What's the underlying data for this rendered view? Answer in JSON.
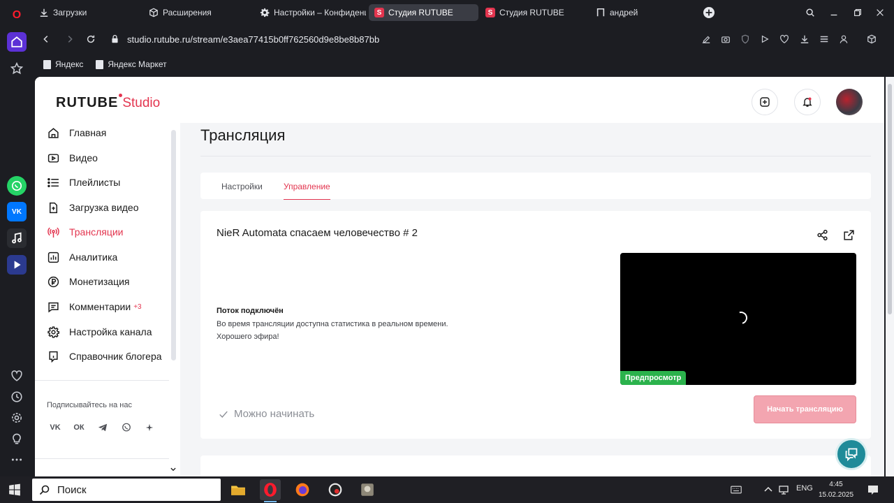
{
  "browser": {
    "tabs": [
      {
        "label": "Загрузки",
        "icon": "download-icon"
      },
      {
        "label": "Расширения",
        "icon": "cube-icon"
      },
      {
        "label": "Настройки – Конфиденц",
        "icon": "gear-icon"
      },
      {
        "label": "Студия RUTUBE",
        "icon": "rutube-s-icon",
        "active": true
      },
      {
        "label": "Студия RUTUBE",
        "icon": "rutube-s-icon"
      },
      {
        "label": "андрей",
        "icon": "p-icon"
      }
    ],
    "url": "studio.rutube.ru/stream/e3aea77415b0ff762560d9e8be8b87bb",
    "bookmarks": [
      "Яндекс",
      "Яндекс Маркет"
    ],
    "logo_letter": "O"
  },
  "site": {
    "logo_main": "RUTUBE",
    "logo_studio": "Studio",
    "tab_logo_letter": "S"
  },
  "sidebar": {
    "items": [
      {
        "label": "Главная",
        "icon": "home-icon"
      },
      {
        "label": "Видео",
        "icon": "video-icon"
      },
      {
        "label": "Плейлисты",
        "icon": "list-icon"
      },
      {
        "label": "Загрузка видео",
        "icon": "upload-icon"
      },
      {
        "label": "Трансляции",
        "icon": "broadcast-icon",
        "active": true
      },
      {
        "label": "Аналитика",
        "icon": "analytics-icon"
      },
      {
        "label": "Монетизация",
        "icon": "ruble-icon"
      },
      {
        "label": "Комментарии",
        "icon": "comment-icon",
        "badge": "+3"
      },
      {
        "label": "Настройка канала",
        "icon": "gear-icon"
      },
      {
        "label": "Справочник блогера",
        "icon": "info-icon"
      }
    ],
    "social_title": "Подписывайтесь на нас",
    "social": [
      "vk",
      "ok",
      "telegram",
      "viber",
      "more"
    ],
    "social_text": {
      "vk": "VK",
      "ok": "ОК"
    }
  },
  "main": {
    "title": "Трансляция",
    "tabs": [
      "Настройки",
      "Управление"
    ],
    "active_tab": "Управление",
    "stream": {
      "name": "NieR Automata спасаем человечество # 2",
      "status_title": "Поток подключён",
      "status_desc_1": "Во время трансляции доступна статистика в реальном времени.",
      "status_desc_2": "Хорошего эфира!",
      "preview_label": "Предпросмотр",
      "ready_text": "Можно начинать",
      "start_button": "Начать трансляцию"
    }
  },
  "taskbar": {
    "search_placeholder": "Поиск",
    "lang": "ENG",
    "time": "4:45",
    "date": "15.02.2025"
  },
  "colors": {
    "accent": "#e3354f",
    "preview_badge": "#2bb24c",
    "start_button_disabled": "#f3a5b0",
    "help_fab": "#1f8b99"
  }
}
